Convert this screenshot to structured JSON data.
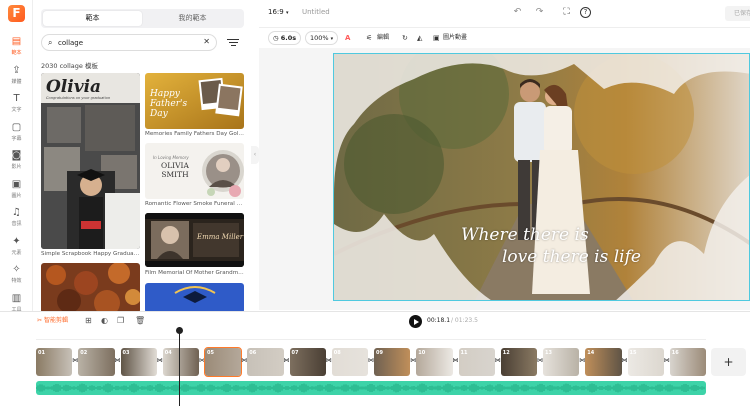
{
  "app": {
    "logo_letter": "F",
    "brand_color": "#ff5a1f"
  },
  "rail": {
    "items": [
      {
        "label": "範本",
        "icon": "template-icon",
        "glyph": "▤",
        "active": true
      },
      {
        "label": "媒體",
        "icon": "media-upload-icon",
        "glyph": "⇪"
      },
      {
        "label": "文字",
        "icon": "text-icon",
        "glyph": "T"
      },
      {
        "label": "字幕",
        "icon": "subtitle-icon",
        "glyph": "▢"
      },
      {
        "label": "影片",
        "icon": "video-icon",
        "glyph": "◙"
      },
      {
        "label": "圖片",
        "icon": "image-icon",
        "glyph": "▣"
      },
      {
        "label": "音訊",
        "icon": "music-icon",
        "glyph": "♫"
      },
      {
        "label": "元素",
        "icon": "elements-icon",
        "glyph": "✦"
      },
      {
        "label": "特效",
        "icon": "effects-icon",
        "glyph": "✧"
      },
      {
        "label": "工具",
        "icon": "tools-icon",
        "glyph": "▥"
      }
    ]
  },
  "panel": {
    "tabs": {
      "templates": "範本",
      "my_templates": "我的範本"
    },
    "search": {
      "value": "collage"
    },
    "result_count": "2030 collage 模板",
    "templates": [
      {
        "caption": "Simple Scrapbook Happy Graduation ...",
        "overlay": "Olivia",
        "sub": "Congratulations on your graduation"
      },
      {
        "caption": "Memories Family Fathers Day Golden...",
        "overlay": "Happy Father's Day"
      },
      {
        "caption": "Romantic Flower Smoke Funeral Me...",
        "overlay": "OLIVIA SMITH",
        "sub": "In Loving Memory"
      },
      {
        "caption": "Film Memorial Of Mother Grandmoth...",
        "overlay": "Emma Miller"
      },
      {
        "caption": ""
      },
      {
        "caption": ""
      }
    ]
  },
  "topbar": {
    "ratio": "16:9",
    "title": "Untitled",
    "icons": [
      "undo-icon",
      "redo-icon",
      "screenshot-icon",
      "help-icon"
    ],
    "export_label": "已保存"
  },
  "toolbar2": {
    "duration": "6.0s",
    "zoom": "100%",
    "edit_label": "編輯",
    "animation_label": "圖片動畫"
  },
  "canvas": {
    "line1": "Where there is",
    "line2": "love there is life",
    "frame_color": "#4fc9df"
  },
  "timeline": {
    "auto_label": "智能剪輯",
    "time_current": "00:18.1",
    "time_total": "/ 01:23.5",
    "clip_numbers": [
      "01",
      "02",
      "03",
      "04",
      "05",
      "06",
      "07",
      "08",
      "09",
      "10",
      "11",
      "12",
      "13",
      "14",
      "15",
      "16"
    ],
    "selected_clip": 4,
    "add_glyph": "+",
    "audio_color": "#3dd3a8"
  }
}
